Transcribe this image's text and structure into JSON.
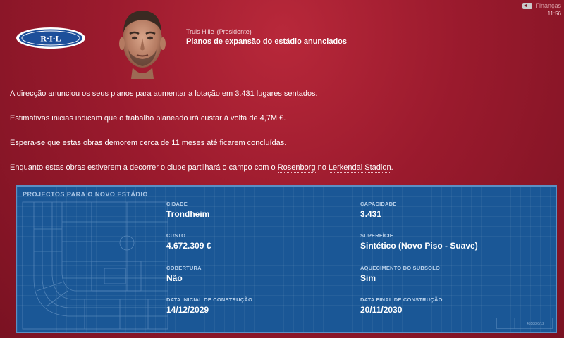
{
  "topbar": {
    "finance_label": "Finanças",
    "clock": "11:56"
  },
  "logo": {
    "text": "R·I·L"
  },
  "message": {
    "sender_name": "Truls Hille",
    "sender_role": "(Presidente)",
    "headline": "Planos de expansão do estádio anunciados",
    "paragraph1": "A direcção anunciou os seus planos para aumentar a lotação em 3.431 lugares sentados.",
    "paragraph2": "Estimativas inicias indicam que o trabalho planeado irá custar à volta de 4,7M €.",
    "paragraph3": "Espera-se que estas obras demorem cerca de 11 meses até ficarem concluídas.",
    "paragraph4_prefix": "Enquanto estas obras estiverem a decorrer o clube partilhará o campo com o ",
    "paragraph4_club": "Rosenborg",
    "paragraph4_mid": " no ",
    "paragraph4_stadium": "Lerkendal Stadion",
    "paragraph4_suffix": "."
  },
  "panel": {
    "title": "PROJECTOS PARA O NOVO ESTÁDIO",
    "blueprint_code": "45588.0/12",
    "city_label": "CIDADE",
    "city_value": "Trondheim",
    "capacity_label": "CAPACIDADE",
    "capacity_value": "3.431",
    "cost_label": "CUSTO",
    "cost_value": "4.672.309 €",
    "surface_label": "SUPERFÍCIE",
    "surface_value": "Sintético (Novo Piso - Suave)",
    "cover_label": "COBERTURA",
    "cover_value": "Não",
    "heating_label": "AQUECIMENTO DO SUBSOLO",
    "heating_value": "Sim",
    "start_label": "DATA INICIAL DE CONSTRUÇÃO",
    "start_value": "14/12/2029",
    "end_label": "DATA FINAL DE CONSTRUÇÃO",
    "end_value": "20/11/2030"
  }
}
